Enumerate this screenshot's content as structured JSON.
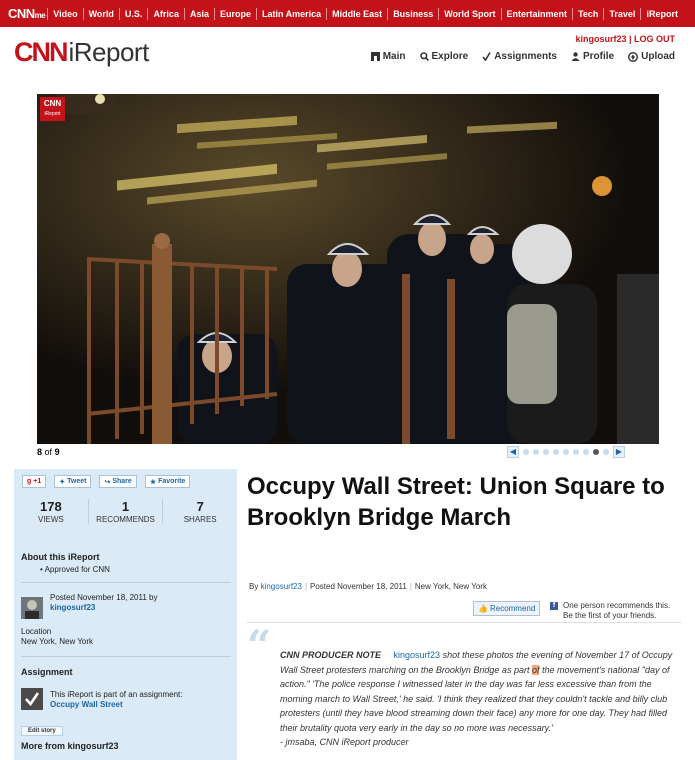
{
  "topnav": {
    "brand": "CNN",
    "brand_suffix": "me",
    "items": [
      "Video",
      "World",
      "U.S.",
      "Africa",
      "Asia",
      "Europe",
      "Latin America",
      "Middle East",
      "Business",
      "World Sport",
      "Entertainment",
      "Tech",
      "Travel",
      "iReport"
    ]
  },
  "header": {
    "logo_cnn": "CNN",
    "logo_ireport": "iReport",
    "username": "kingosurf23",
    "logout": "LOG OUT",
    "nav": [
      "Main",
      "Explore",
      "Assignments",
      "Profile",
      "Upload"
    ]
  },
  "slideshow": {
    "badge_cnn": "CNN",
    "badge_ireport": "iReport",
    "current": "8",
    "of_label": "of",
    "total": "9",
    "dots": 9,
    "active_dot": 8
  },
  "sidebar": {
    "share": {
      "gplus": "+1",
      "tweet": "Tweet",
      "share": "Share",
      "favorite": "Favorite"
    },
    "stats": [
      {
        "num": "178",
        "label": "VIEWS"
      },
      {
        "num": "1",
        "label": "RECOMMENDS"
      },
      {
        "num": "7",
        "label": "SHARES"
      }
    ],
    "about_heading": "About this iReport",
    "approved": "Approved for CNN",
    "posted_line": "Posted November 18, 2011 by",
    "posted_user": "kingosurf23",
    "location_label": "Location",
    "location_value": "New York, New York",
    "assignment_heading": "Assignment",
    "assignment_text": "This iReport is part of an assignment:",
    "assignment_link": "Occupy Wall Street",
    "edit_story": "Edit story",
    "more_from": "More from kingosurf23"
  },
  "article": {
    "title": "Occupy Wall Street: Union Square to Brooklyn Bridge March",
    "byline_by": "By",
    "byline_user": "kingosurf23",
    "byline_posted": "Posted November 18, 2011",
    "byline_location": "New York, New York",
    "recommend_button": "Recommend",
    "fb_text": "One person recommends this. Be the first of your friends.",
    "producer_label": "CNN PRODUCER NOTE",
    "producer_user": "kingosurf23",
    "producer_text_1": " shot these photos the evening of November 17 of Occupy Wall Street protesters marching on the Brooklyn Bridge as part ",
    "producer_hl": "of",
    "producer_text_2": " the movement's national \"day of action.\" 'The police response I witnessed later in the day was far less excessive than from the morning march to Wall Street,' he said. 'I think they realized that they couldn't tackle and billy club protesters (until they have blood streaming down their face) any more for one day. They had filled their brutality quota very early in the day so no more was necessary.'",
    "producer_sign": "- jmsaba, CNN iReport producer"
  },
  "colors": {
    "brand_red": "#c4121a",
    "link_blue": "#1c67a6",
    "sidebar_bg": "#daeaf6"
  }
}
